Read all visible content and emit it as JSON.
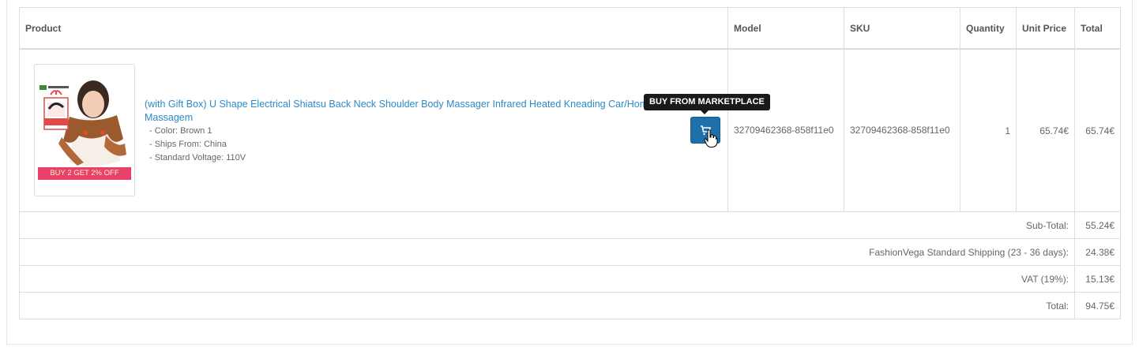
{
  "columns": {
    "product": "Product",
    "model": "Model",
    "sku": "SKU",
    "quantity": "Quantity",
    "unit_price": "Unit Price",
    "total": "Total"
  },
  "item": {
    "image_caption": "BUY 2 GET 2% OFF",
    "name": "(with Gift Box) U Shape Electrical Shiatsu Back Neck Shoulder Body Massager Infrared Heated Kneading Car/Home Massagem",
    "options": [
      "- Color: Brown 1",
      "- Ships From: China",
      "- Standard Voltage: 110V"
    ],
    "model": "32709462368-858f11e0",
    "sku": "32709462368-858f11e0",
    "quantity": "1",
    "unit_price": "65.74€",
    "total": "65.74€",
    "buy_tooltip": "BUY FROM MARKETPLACE",
    "buy_icon": "cart-icon"
  },
  "totals": [
    {
      "label": "Sub-Total:",
      "value": "55.24€"
    },
    {
      "label": "FashionVega Standard Shipping (23 - 36 days):",
      "value": "24.38€"
    },
    {
      "label": "VAT (19%):",
      "value": "15.13€"
    },
    {
      "label": "Total:",
      "value": "94.75€"
    }
  ],
  "colors": {
    "link": "#2a8ac8",
    "button": "#1f6fa8",
    "tooltip": "#1a1a1a",
    "promo": "#e8416b"
  }
}
